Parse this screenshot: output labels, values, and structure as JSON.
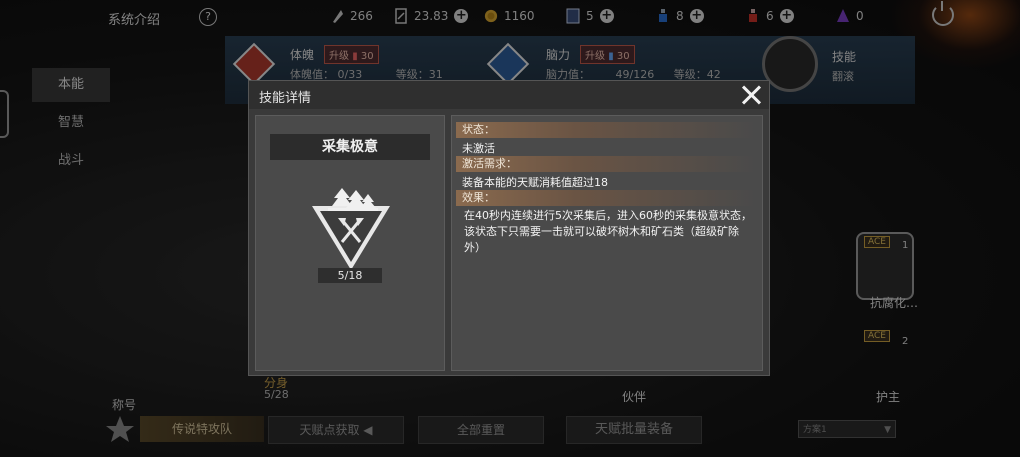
{
  "topbar": {
    "title": "系统介绍",
    "help": "?",
    "resources": [
      {
        "icon": "leaf-icon",
        "value": "266",
        "plus": false
      },
      {
        "icon": "card-icon",
        "value": "23.83",
        "plus": true
      },
      {
        "icon": "coin-icon",
        "value": "1160",
        "plus": false
      },
      {
        "icon": "book-icon",
        "value": "5",
        "plus": true
      },
      {
        "icon": "blue-potion-icon",
        "value": "8",
        "plus": true
      },
      {
        "icon": "red-potion-icon",
        "value": "6",
        "plus": true
      },
      {
        "icon": "purple-crystal-icon",
        "value": "0",
        "plus": false
      }
    ]
  },
  "sidebar": {
    "items": [
      "本能",
      "智慧",
      "战斗"
    ],
    "active": 0
  },
  "background": {
    "stat1": {
      "name": "体魄",
      "upgrade": "升级",
      "cost": "30",
      "line2a": "体魄值：",
      "line2b": "0/33",
      "line2c": "等级：31"
    },
    "stat2": {
      "name": "脑力",
      "upgrade": "升级",
      "cost": "30",
      "line2a": "脑力值：",
      "line2b": "49/126",
      "line2c": "等级：42"
    },
    "stat3": {
      "name": "技能",
      "sub": "翻滚"
    },
    "nodes": {
      "ace1": "ACE",
      "node1_count": "1",
      "node1_label": "抗腐化…",
      "ace2": "ACE",
      "node2_count": "2",
      "node2_label": "护主",
      "left_label": "分身",
      "left_count": "5/28",
      "mid_label": "伙伴"
    }
  },
  "bottom": {
    "title_label": "称号",
    "title_value": "传说特攻队",
    "talent_get": "天赋点获取",
    "reset": "全部重置",
    "batch_equip": "天赋批量装备",
    "scheme": "方案1"
  },
  "modal": {
    "title": "技能详情",
    "skill_name": "采集极意",
    "progress": "5/18",
    "status_head": "状态：",
    "status_val": "未激活",
    "req_head": "激活需求：",
    "req_val": "装备本能的天赋消耗值超过18",
    "effect_head": "效果：",
    "effect_val": "在40秒内连续进行5次采集后，进入60秒的采集极意状态，该状态下只需要一击就可以破坏树木和矿石类（超级矿除外）"
  }
}
